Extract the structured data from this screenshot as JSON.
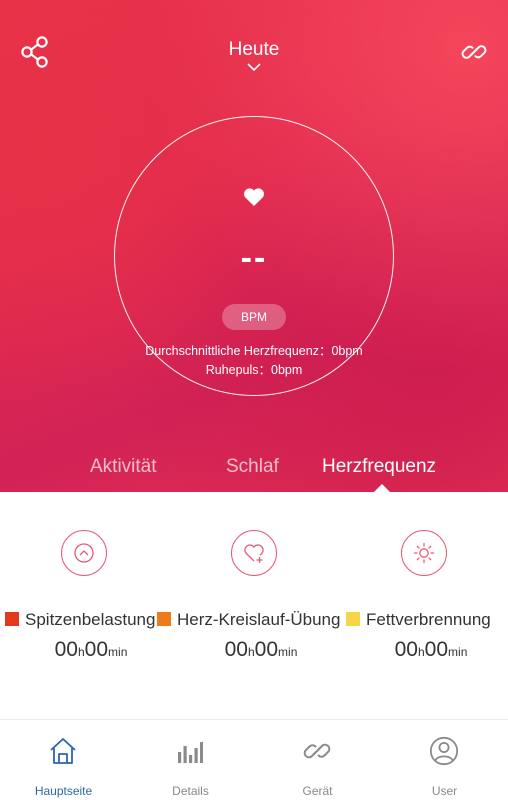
{
  "header": {
    "date_label": "Heute",
    "share_icon": "share-icon",
    "link_icon": "link-icon"
  },
  "heart_rate": {
    "icon": "heart-icon",
    "value": "--",
    "unit_badge": "BPM",
    "average_text": "Durchschnittliche Herzfrequenz：0bpm",
    "resting_text": "Ruhepuls：0bpm"
  },
  "tabs": [
    {
      "label": "Aktivität",
      "active": false
    },
    {
      "label": "Schlaf",
      "active": false
    },
    {
      "label": "Herzfrequenz",
      "active": true
    }
  ],
  "zones": [
    {
      "icon": "chevron-up-circle-icon",
      "name": "Spitzenbelastung",
      "color": "#e23a1c",
      "hours": "00",
      "hours_unit": "h",
      "minutes": "00",
      "minutes_unit": "min"
    },
    {
      "icon": "heart-plus-icon",
      "name": "Herz-Kreislauf-Übung",
      "color": "#ef7a1a",
      "hours": "00",
      "hours_unit": "h",
      "minutes": "00",
      "minutes_unit": "min"
    },
    {
      "icon": "sun-icon",
      "name": "Fettverbrennung",
      "color": "#f7d548",
      "hours": "00",
      "hours_unit": "h",
      "minutes": "00",
      "minutes_unit": "min"
    }
  ],
  "colors": {
    "accent": "#e8324a",
    "zone_icon_stroke": "#e85a79",
    "nav_active": "#2a66b0",
    "nav_inactive": "#8a8a8a"
  },
  "bottom_nav": [
    {
      "label": "Hauptseite",
      "icon": "home-icon",
      "active": true
    },
    {
      "label": "Details",
      "icon": "bar-chart-icon",
      "active": false
    },
    {
      "label": "Gerät",
      "icon": "link-icon",
      "active": false
    },
    {
      "label": "User",
      "icon": "user-icon",
      "active": false
    }
  ]
}
